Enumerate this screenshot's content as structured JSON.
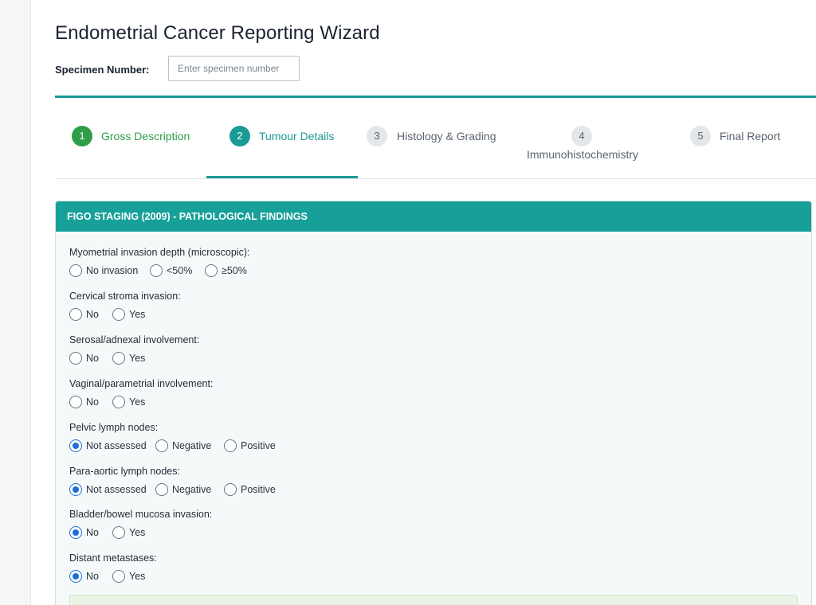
{
  "wizard": {
    "title": "Endometrial Cancer Reporting Wizard",
    "specimen_label": "Specimen Number:",
    "specimen_placeholder": "Enter specimen number",
    "specimen_value": ""
  },
  "steps": [
    {
      "number": "1",
      "label": "Gross Description",
      "state": "done"
    },
    {
      "number": "2",
      "label": "Tumour Details",
      "state": "active"
    },
    {
      "number": "3",
      "label": "Histology & Grading",
      "state": "pending"
    },
    {
      "number": "4",
      "label": "Immunohistochemistry",
      "state": "pending"
    },
    {
      "number": "5",
      "label": "Final Report",
      "state": "pending"
    }
  ],
  "section": {
    "header": "FIGO STAGING (2009) - PATHOLOGICAL FINDINGS",
    "questions": [
      {
        "label": "Myometrial invasion depth (microscopic):",
        "options": [
          "No invasion",
          "<50%",
          "≥50%"
        ],
        "selected": null
      },
      {
        "label": "Cervical stroma invasion:",
        "options": [
          "No",
          "Yes"
        ],
        "selected": null
      },
      {
        "label": "Serosal/adnexal involvement:",
        "options": [
          "No",
          "Yes"
        ],
        "selected": null
      },
      {
        "label": "Vaginal/parametrial involvement:",
        "options": [
          "No",
          "Yes"
        ],
        "selected": null
      },
      {
        "label": "Pelvic lymph nodes:",
        "options": [
          "Not assessed",
          "Negative",
          "Positive"
        ],
        "selected": "Not assessed"
      },
      {
        "label": "Para-aortic lymph nodes:",
        "options": [
          "Not assessed",
          "Negative",
          "Positive"
        ],
        "selected": "Not assessed"
      },
      {
        "label": "Bladder/bowel mucosa invasion:",
        "options": [
          "No",
          "Yes"
        ],
        "selected": "No"
      },
      {
        "label": "Distant metastases:",
        "options": [
          "No",
          "Yes"
        ],
        "selected": "No"
      }
    ]
  },
  "colors": {
    "accent_teal": "#1b9a96",
    "done_green": "#2e9e49",
    "radio_blue": "#1a6fd8"
  }
}
